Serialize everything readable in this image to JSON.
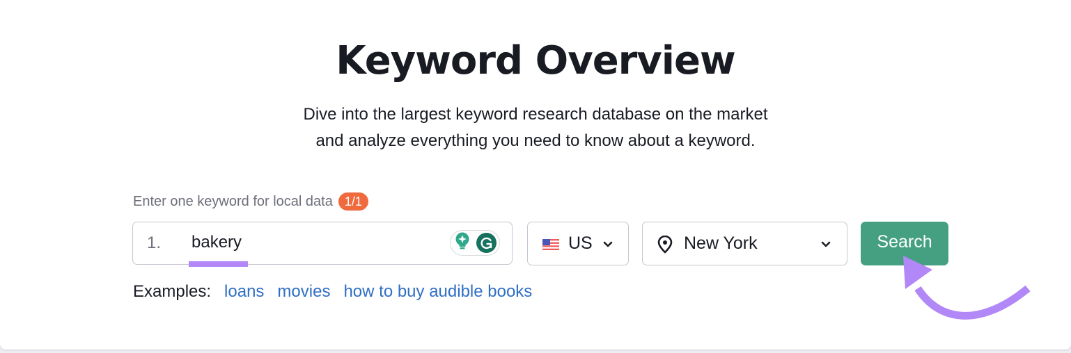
{
  "header": {
    "title": "Keyword Overview",
    "subtitle_line1": "Dive into the largest keyword research database on the market",
    "subtitle_line2": "and analyze everything you need to know about a keyword."
  },
  "form": {
    "label": "Enter one keyword for local data",
    "badge": "1/1",
    "keyword_number": "1.",
    "keyword_value": "bakery",
    "extension_icons": [
      "lightbulb-icon",
      "grammarly-icon"
    ],
    "database": {
      "flag": "us-flag-icon",
      "value": "US"
    },
    "location": {
      "icon": "location-pin-icon",
      "value": "New York"
    },
    "search_label": "Search"
  },
  "examples": {
    "label": "Examples:",
    "links": [
      "loans",
      "movies",
      "how to buy audible books"
    ]
  },
  "colors": {
    "accent_green": "#45a081",
    "badge_orange": "#f06a3d",
    "link_blue": "#2f6fc4",
    "annotation_purple": "#b287f7"
  }
}
